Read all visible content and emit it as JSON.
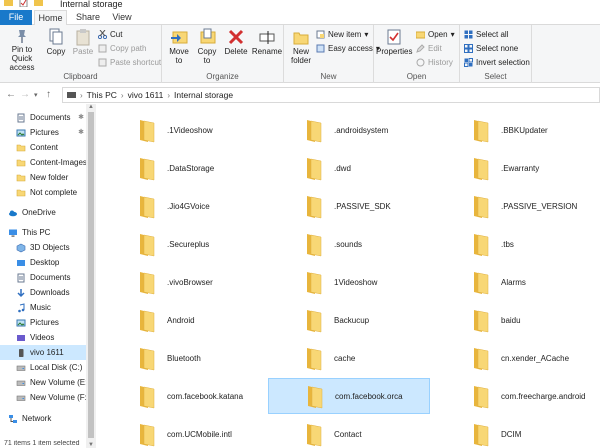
{
  "window": {
    "title": "Internal storage"
  },
  "tabs": [
    {
      "label": "File"
    },
    {
      "label": "Home"
    },
    {
      "label": "Share"
    },
    {
      "label": "View"
    }
  ],
  "ribbon": {
    "clipboard": {
      "label": "Clipboard",
      "pin": "Pin to Quick access",
      "copy": "Copy",
      "paste": "Paste",
      "cut": "Cut",
      "copy_path": "Copy path",
      "paste_shortcut": "Paste shortcut"
    },
    "organize": {
      "label": "Organize",
      "move_to": "Move to",
      "copy_to": "Copy to",
      "delete": "Delete",
      "rename": "Rename"
    },
    "new": {
      "label": "New",
      "new_folder": "New folder",
      "new_item": "New item",
      "easy_access": "Easy access"
    },
    "open": {
      "label": "Open",
      "properties": "Properties",
      "open": "Open",
      "edit": "Edit",
      "history": "History"
    },
    "select": {
      "label": "Select",
      "select_all": "Select all",
      "select_none": "Select none",
      "invert_selection": "Invert selection"
    }
  },
  "address": {
    "crumbs": [
      "This PC",
      "vivo 1611",
      "Internal storage"
    ]
  },
  "nav": {
    "items": [
      {
        "label": "Documents",
        "pinned": true
      },
      {
        "label": "Pictures",
        "pinned": true
      },
      {
        "label": "Content",
        "pinned": false
      },
      {
        "label": "Content-Images",
        "pinned": false
      },
      {
        "label": "New folder",
        "pinned": false
      },
      {
        "label": "Not complete",
        "pinned": false
      },
      {
        "label": "OneDrive"
      },
      {
        "label": "This PC"
      },
      {
        "label": "3D Objects"
      },
      {
        "label": "Desktop"
      },
      {
        "label": "Documents"
      },
      {
        "label": "Downloads"
      },
      {
        "label": "Music"
      },
      {
        "label": "Pictures"
      },
      {
        "label": "Videos"
      },
      {
        "label": "vivo 1611",
        "selected": true
      },
      {
        "label": "Local Disk (C:)"
      },
      {
        "label": "New Volume (E:)"
      },
      {
        "label": "New Volume (F:)"
      },
      {
        "label": "Network"
      }
    ]
  },
  "files": [
    ".1Videoshow",
    ".androidsystem",
    ".BBKUpdater",
    ".DataStorage",
    ".dwd",
    ".Ewarranty",
    ".Jio4GVoice",
    ".PASSIVE_SDK",
    ".PASSIVE_VERSION",
    ".Secureplus",
    ".sounds",
    ".tbs",
    ".vivoBrowser",
    "1Videoshow",
    "Alarms",
    "Android",
    "Backucup",
    "baidu",
    "Bluetooth",
    "cache",
    "cn.xender_ACache",
    "com.facebook.katana",
    "com.facebook.orca",
    "com.freecharge.android",
    "com.UCMobile.intl",
    "Contact",
    "DCIM"
  ],
  "selected_file": "com.facebook.orca",
  "status": {
    "text": "71 items  1 item selected"
  },
  "colors": {
    "accent": "#1979ca",
    "selection": "#cce8ff",
    "folder": "#f8d775"
  }
}
